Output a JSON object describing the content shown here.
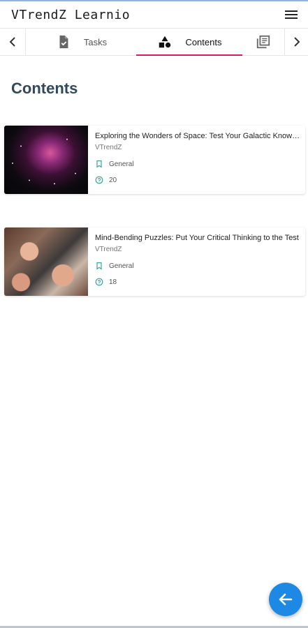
{
  "app": {
    "title": "VTrendZ Learnio",
    "menu_icon": "hamburger-menu-icon"
  },
  "tabs": {
    "prev_icon": "chevron-left-icon",
    "next_icon": "chevron-right-icon",
    "items": [
      {
        "label": "Tasks",
        "icon": "task-checklist-icon",
        "active": false
      },
      {
        "label": "Contents",
        "icon": "shapes-icon",
        "active": true
      },
      {
        "label": "",
        "icon": "library-books-icon",
        "active": false
      }
    ],
    "active_color": "#d81b60"
  },
  "main": {
    "heading": "Contents",
    "cards": [
      {
        "title": "Exploring the Wonders of Space: Test Your Galactic Knowledge",
        "author": "VTrendZ",
        "category": "General",
        "count": "20",
        "thumb": "space-nebula-image"
      },
      {
        "title": "Mind-Bending Puzzles: Put Your Critical Thinking to the Test",
        "author": "VTrendZ",
        "category": "General",
        "count": "18",
        "thumb": "jigsaw-puzzle-image"
      }
    ]
  },
  "fab": {
    "icon": "arrow-left-icon",
    "color": "#1e88e5"
  },
  "colors": {
    "heading": "#2e4a5c",
    "meta_icon": "#3aa39a"
  }
}
